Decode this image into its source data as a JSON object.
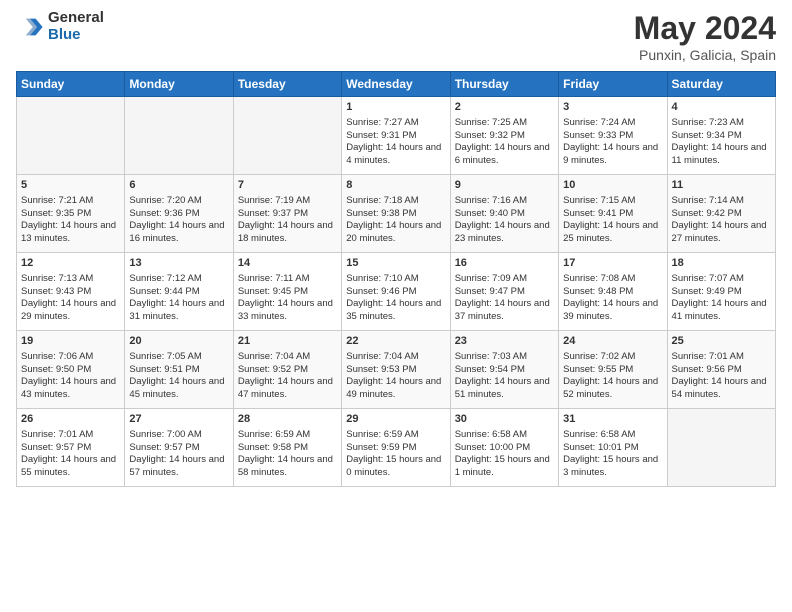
{
  "header": {
    "logo_general": "General",
    "logo_blue": "Blue",
    "title": "May 2024",
    "subtitle": "Punxin, Galicia, Spain"
  },
  "days_of_week": [
    "Sunday",
    "Monday",
    "Tuesday",
    "Wednesday",
    "Thursday",
    "Friday",
    "Saturday"
  ],
  "weeks": [
    [
      {
        "day": "",
        "empty": true
      },
      {
        "day": "",
        "empty": true
      },
      {
        "day": "",
        "empty": true
      },
      {
        "day": "1",
        "sunrise": "7:27 AM",
        "sunset": "9:31 PM",
        "daylight": "14 hours and 4 minutes."
      },
      {
        "day": "2",
        "sunrise": "7:25 AM",
        "sunset": "9:32 PM",
        "daylight": "14 hours and 6 minutes."
      },
      {
        "day": "3",
        "sunrise": "7:24 AM",
        "sunset": "9:33 PM",
        "daylight": "14 hours and 9 minutes."
      },
      {
        "day": "4",
        "sunrise": "7:23 AM",
        "sunset": "9:34 PM",
        "daylight": "14 hours and 11 minutes."
      }
    ],
    [
      {
        "day": "5",
        "sunrise": "7:21 AM",
        "sunset": "9:35 PM",
        "daylight": "14 hours and 13 minutes."
      },
      {
        "day": "6",
        "sunrise": "7:20 AM",
        "sunset": "9:36 PM",
        "daylight": "14 hours and 16 minutes."
      },
      {
        "day": "7",
        "sunrise": "7:19 AM",
        "sunset": "9:37 PM",
        "daylight": "14 hours and 18 minutes."
      },
      {
        "day": "8",
        "sunrise": "7:18 AM",
        "sunset": "9:38 PM",
        "daylight": "14 hours and 20 minutes."
      },
      {
        "day": "9",
        "sunrise": "7:16 AM",
        "sunset": "9:40 PM",
        "daylight": "14 hours and 23 minutes."
      },
      {
        "day": "10",
        "sunrise": "7:15 AM",
        "sunset": "9:41 PM",
        "daylight": "14 hours and 25 minutes."
      },
      {
        "day": "11",
        "sunrise": "7:14 AM",
        "sunset": "9:42 PM",
        "daylight": "14 hours and 27 minutes."
      }
    ],
    [
      {
        "day": "12",
        "sunrise": "7:13 AM",
        "sunset": "9:43 PM",
        "daylight": "14 hours and 29 minutes."
      },
      {
        "day": "13",
        "sunrise": "7:12 AM",
        "sunset": "9:44 PM",
        "daylight": "14 hours and 31 minutes."
      },
      {
        "day": "14",
        "sunrise": "7:11 AM",
        "sunset": "9:45 PM",
        "daylight": "14 hours and 33 minutes."
      },
      {
        "day": "15",
        "sunrise": "7:10 AM",
        "sunset": "9:46 PM",
        "daylight": "14 hours and 35 minutes."
      },
      {
        "day": "16",
        "sunrise": "7:09 AM",
        "sunset": "9:47 PM",
        "daylight": "14 hours and 37 minutes."
      },
      {
        "day": "17",
        "sunrise": "7:08 AM",
        "sunset": "9:48 PM",
        "daylight": "14 hours and 39 minutes."
      },
      {
        "day": "18",
        "sunrise": "7:07 AM",
        "sunset": "9:49 PM",
        "daylight": "14 hours and 41 minutes."
      }
    ],
    [
      {
        "day": "19",
        "sunrise": "7:06 AM",
        "sunset": "9:50 PM",
        "daylight": "14 hours and 43 minutes."
      },
      {
        "day": "20",
        "sunrise": "7:05 AM",
        "sunset": "9:51 PM",
        "daylight": "14 hours and 45 minutes."
      },
      {
        "day": "21",
        "sunrise": "7:04 AM",
        "sunset": "9:52 PM",
        "daylight": "14 hours and 47 minutes."
      },
      {
        "day": "22",
        "sunrise": "7:04 AM",
        "sunset": "9:53 PM",
        "daylight": "14 hours and 49 minutes."
      },
      {
        "day": "23",
        "sunrise": "7:03 AM",
        "sunset": "9:54 PM",
        "daylight": "14 hours and 51 minutes."
      },
      {
        "day": "24",
        "sunrise": "7:02 AM",
        "sunset": "9:55 PM",
        "daylight": "14 hours and 52 minutes."
      },
      {
        "day": "25",
        "sunrise": "7:01 AM",
        "sunset": "9:56 PM",
        "daylight": "14 hours and 54 minutes."
      }
    ],
    [
      {
        "day": "26",
        "sunrise": "7:01 AM",
        "sunset": "9:57 PM",
        "daylight": "14 hours and 55 minutes."
      },
      {
        "day": "27",
        "sunrise": "7:00 AM",
        "sunset": "9:57 PM",
        "daylight": "14 hours and 57 minutes."
      },
      {
        "day": "28",
        "sunrise": "6:59 AM",
        "sunset": "9:58 PM",
        "daylight": "14 hours and 58 minutes."
      },
      {
        "day": "29",
        "sunrise": "6:59 AM",
        "sunset": "9:59 PM",
        "daylight": "15 hours and 0 minutes."
      },
      {
        "day": "30",
        "sunrise": "6:58 AM",
        "sunset": "10:00 PM",
        "daylight": "15 hours and 1 minute."
      },
      {
        "day": "31",
        "sunrise": "6:58 AM",
        "sunset": "10:01 PM",
        "daylight": "15 hours and 3 minutes."
      },
      {
        "day": "",
        "empty": true
      }
    ]
  ]
}
